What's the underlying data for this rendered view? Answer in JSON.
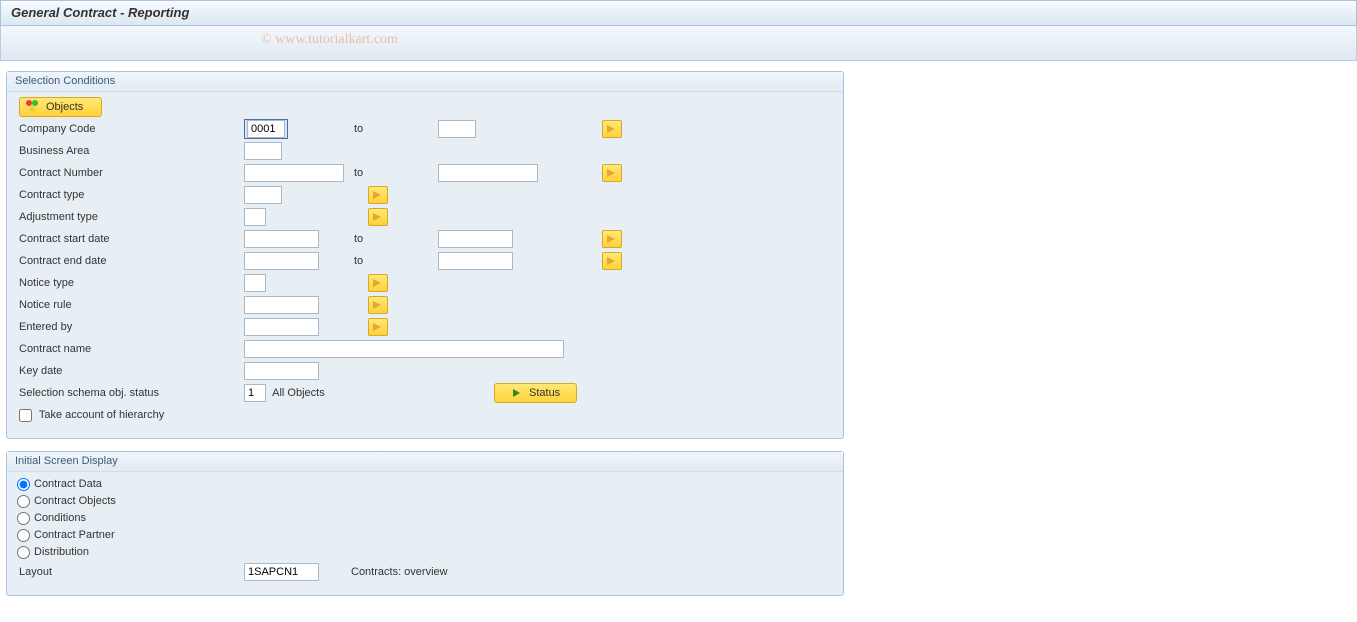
{
  "header": {
    "title": "General Contract - Reporting"
  },
  "watermark": "© www.tutorialkart.com",
  "selection": {
    "title": "Selection Conditions",
    "objects_btn": "Objects",
    "status_btn": "Status",
    "rows": {
      "company_code": {
        "label": "Company Code",
        "from": "0001",
        "to_label": "to",
        "to": ""
      },
      "business_area": {
        "label": "Business Area",
        "from": ""
      },
      "contract_number": {
        "label": "Contract Number",
        "from": "",
        "to_label": "to",
        "to": ""
      },
      "contract_type": {
        "label": "Contract type",
        "from": ""
      },
      "adjustment_type": {
        "label": "Adjustment type",
        "from": ""
      },
      "contract_start": {
        "label": "Contract start date",
        "from": "",
        "to_label": "to",
        "to": ""
      },
      "contract_end": {
        "label": "Contract end date",
        "from": "",
        "to_label": "to",
        "to": ""
      },
      "notice_type": {
        "label": "Notice type",
        "from": ""
      },
      "notice_rule": {
        "label": "Notice rule",
        "from": ""
      },
      "entered_by": {
        "label": "Entered by",
        "from": ""
      },
      "contract_name": {
        "label": "Contract name",
        "value": ""
      },
      "key_date": {
        "label": "Key date",
        "value": ""
      },
      "sel_schema": {
        "label": "Selection schema obj. status",
        "value": "1",
        "desc": "All Objects"
      },
      "hierarchy": {
        "label": "Take account of hierarchy"
      }
    }
  },
  "initial_display": {
    "title": "Initial Screen Display",
    "options": {
      "contract_data": "Contract Data",
      "contract_objects": "Contract Objects",
      "conditions": "Conditions",
      "contract_partner": "Contract Partner",
      "distribution": "Distribution"
    },
    "selected": "contract_data",
    "layout": {
      "label": "Layout",
      "value": "1SAPCN1",
      "desc": "Contracts: overview"
    }
  }
}
